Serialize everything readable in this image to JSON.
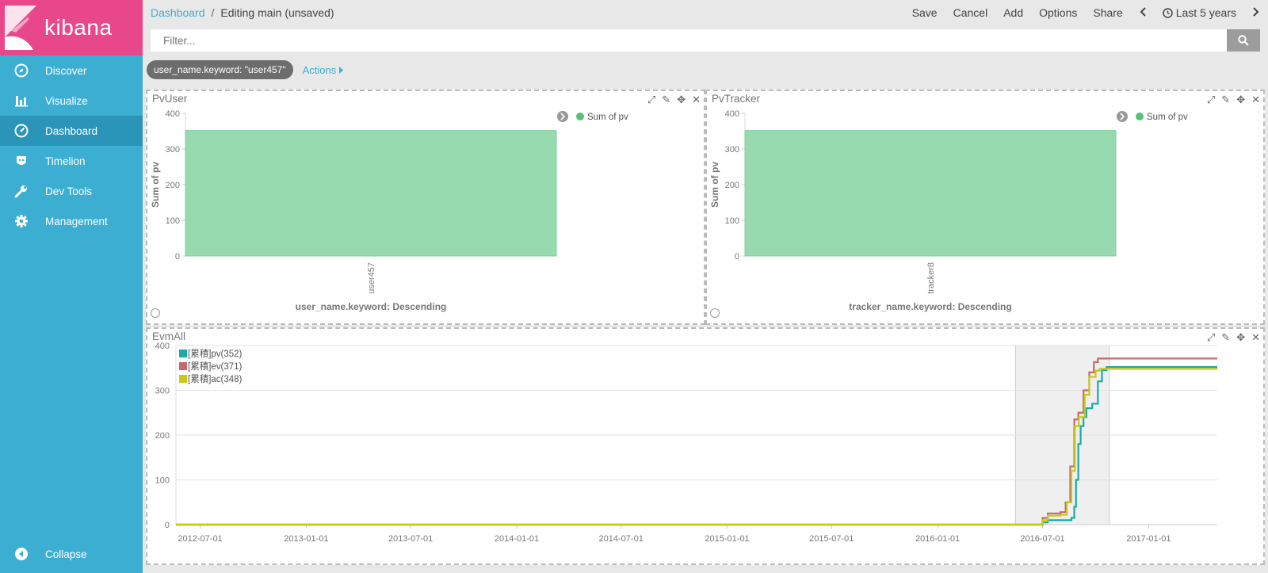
{
  "app": {
    "name": "kibana"
  },
  "sidebar": {
    "items": [
      {
        "label": "Discover",
        "icon": "compass-icon",
        "active": false
      },
      {
        "label": "Visualize",
        "icon": "bar-chart-icon",
        "active": false
      },
      {
        "label": "Dashboard",
        "icon": "dashboard-icon",
        "active": true
      },
      {
        "label": "Timelion",
        "icon": "timelion-icon",
        "active": false
      },
      {
        "label": "Dev Tools",
        "icon": "wrench-icon",
        "active": false
      },
      {
        "label": "Management",
        "icon": "gear-icon",
        "active": false
      }
    ],
    "collapse_label": "Collapse"
  },
  "breadcrumb": {
    "parent": "Dashboard",
    "separator": "/",
    "current": "Editing main (unsaved)"
  },
  "top_menu": {
    "save": "Save",
    "cancel": "Cancel",
    "add": "Add",
    "options": "Options",
    "share": "Share",
    "time_range": "Last 5 years"
  },
  "filter": {
    "placeholder": "Filter...",
    "pill": "user_name.keyword: \"user457\"",
    "actions": "Actions"
  },
  "colors": {
    "sidebar": "#3caed2",
    "logo": "#e8488b",
    "bar": "#98dab0",
    "legend_green": "#57c17b",
    "pv": "#1baaa8",
    "ev": "#c46a6e",
    "ac": "#c6c918"
  },
  "panels": {
    "pvuser": {
      "title": "PvUser"
    },
    "pvtracker": {
      "title": "PvTracker"
    },
    "evmall": {
      "title": "EvmAll"
    }
  },
  "chart_data": [
    {
      "type": "bar",
      "title": "PvUser",
      "categories": [
        "user457"
      ],
      "series": [
        {
          "name": "Sum of pv",
          "values": [
            352
          ]
        }
      ],
      "ylabel": "Sum of pv",
      "xlabel": "user_name.keyword: Descending",
      "ylim": [
        0,
        400
      ],
      "yticks": [
        0,
        100,
        200,
        300,
        400
      ],
      "legend": "top-right"
    },
    {
      "type": "bar",
      "title": "PvTracker",
      "categories": [
        "tracker8"
      ],
      "series": [
        {
          "name": "Sum of pv",
          "values": [
            352
          ]
        }
      ],
      "ylabel": "Sum of pv",
      "xlabel": "tracker_name.keyword: Descending",
      "ylim": [
        0,
        400
      ],
      "yticks": [
        0,
        100,
        200,
        300,
        400
      ],
      "legend": "top-right"
    },
    {
      "type": "line",
      "title": "EvmAll",
      "xlim": [
        "2012-05-20",
        "2017-04-30"
      ],
      "xticks": [
        "2012-07-01",
        "2013-01-01",
        "2013-07-01",
        "2014-01-01",
        "2014-07-01",
        "2015-01-01",
        "2015-07-01",
        "2016-01-01",
        "2016-07-01",
        "2017-01-01"
      ],
      "ylim": [
        0,
        400
      ],
      "yticks": [
        0,
        100,
        200,
        300,
        400
      ],
      "highlight_range": [
        "2016-05-15",
        "2016-10-25"
      ],
      "legend": "top-left",
      "series": [
        {
          "name": "[累積]pv(352)",
          "points": [
            [
              "2012-05-20",
              0
            ],
            [
              "2016-06-15",
              0
            ],
            [
              "2016-07-01",
              5
            ],
            [
              "2016-07-10",
              10
            ],
            [
              "2016-08-20",
              15
            ],
            [
              "2016-08-25",
              40
            ],
            [
              "2016-08-28",
              100
            ],
            [
              "2016-09-01",
              180
            ],
            [
              "2016-09-05",
              220
            ],
            [
              "2016-09-10",
              240
            ],
            [
              "2016-09-15",
              260
            ],
            [
              "2016-09-25",
              270
            ],
            [
              "2016-10-05",
              320
            ],
            [
              "2016-10-12",
              345
            ],
            [
              "2016-10-20",
              352
            ],
            [
              "2017-04-30",
              352
            ]
          ]
        },
        {
          "name": "[累積]ev(371)",
          "points": [
            [
              "2012-05-20",
              0
            ],
            [
              "2016-06-15",
              0
            ],
            [
              "2016-07-01",
              15
            ],
            [
              "2016-07-10",
              25
            ],
            [
              "2016-08-01",
              28
            ],
            [
              "2016-08-10",
              50
            ],
            [
              "2016-08-18",
              130
            ],
            [
              "2016-08-25",
              235
            ],
            [
              "2016-09-01",
              250
            ],
            [
              "2016-09-10",
              300
            ],
            [
              "2016-09-20",
              340
            ],
            [
              "2016-09-28",
              363
            ],
            [
              "2016-10-05",
              371
            ],
            [
              "2017-04-30",
              371
            ]
          ]
        },
        {
          "name": "[累積]ac(348)",
          "points": [
            [
              "2012-05-20",
              0
            ],
            [
              "2016-06-15",
              0
            ],
            [
              "2016-07-01",
              10
            ],
            [
              "2016-07-10",
              20
            ],
            [
              "2016-08-01",
              22
            ],
            [
              "2016-08-12",
              50
            ],
            [
              "2016-08-20",
              120
            ],
            [
              "2016-08-26",
              220
            ],
            [
              "2016-09-02",
              240
            ],
            [
              "2016-09-12",
              290
            ],
            [
              "2016-09-20",
              330
            ],
            [
              "2016-10-01",
              344
            ],
            [
              "2016-10-08",
              348
            ],
            [
              "2017-04-30",
              348
            ]
          ]
        }
      ]
    }
  ]
}
